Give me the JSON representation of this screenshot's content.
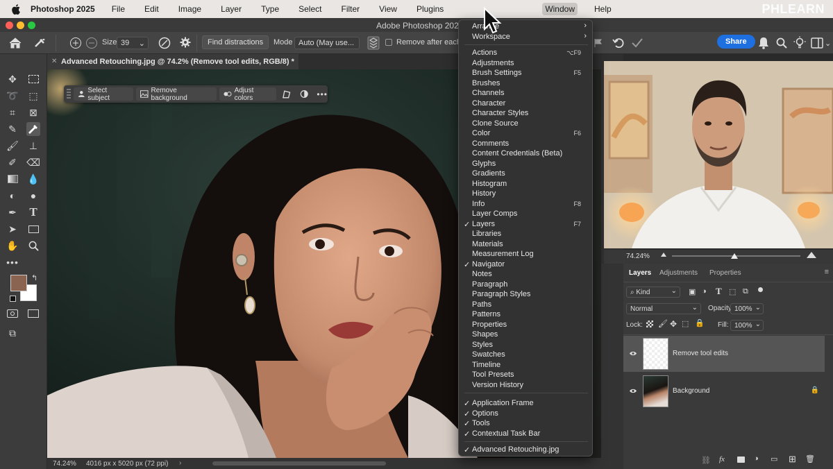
{
  "mac_menubar": {
    "app_name": "Photoshop 2025",
    "items": [
      "File",
      "Edit",
      "Image",
      "Layer",
      "Type",
      "Select",
      "Filter",
      "View",
      "Plugins",
      "Window",
      "Help"
    ],
    "active_item": "Window",
    "brand_watermark": "PHLEARN"
  },
  "window": {
    "title": "Adobe Photoshop 2025"
  },
  "options_bar": {
    "size_label": "Size",
    "size_value": "39",
    "find_distractions": "Find distractions",
    "mode_label": "Mode",
    "mode_value": "Auto (May use...",
    "remove_after_each": "Remove after each",
    "share": "Share"
  },
  "document": {
    "tab_title": "Advanced Retouching.jpg @ 74.2% (Remove tool edits, RGB/8) *",
    "zoom": "74.24%",
    "dimensions": "4016 px x 5020 px (72 ppi)"
  },
  "contextual_task_bar": {
    "select_subject": "Select subject",
    "remove_background": "Remove background",
    "adjust_colors": "Adjust colors"
  },
  "window_menu": {
    "top": [
      {
        "label": "Arrange",
        "submenu": true
      },
      {
        "label": "Workspace",
        "submenu": true
      }
    ],
    "panels": [
      {
        "label": "Actions",
        "shortcut": "⌥F9",
        "checked": false
      },
      {
        "label": "Adjustments",
        "shortcut": "",
        "checked": false
      },
      {
        "label": "Brush Settings",
        "shortcut": "F5",
        "checked": false
      },
      {
        "label": "Brushes",
        "shortcut": "",
        "checked": false
      },
      {
        "label": "Channels",
        "shortcut": "",
        "checked": false
      },
      {
        "label": "Character",
        "shortcut": "",
        "checked": false
      },
      {
        "label": "Character Styles",
        "shortcut": "",
        "checked": false
      },
      {
        "label": "Clone Source",
        "shortcut": "",
        "checked": false
      },
      {
        "label": "Color",
        "shortcut": "F6",
        "checked": false
      },
      {
        "label": "Comments",
        "shortcut": "",
        "checked": false
      },
      {
        "label": "Content Credentials (Beta)",
        "shortcut": "",
        "checked": false
      },
      {
        "label": "Glyphs",
        "shortcut": "",
        "checked": false
      },
      {
        "label": "Gradients",
        "shortcut": "",
        "checked": false
      },
      {
        "label": "Histogram",
        "shortcut": "",
        "checked": false
      },
      {
        "label": "History",
        "shortcut": "",
        "checked": false
      },
      {
        "label": "Info",
        "shortcut": "F8",
        "checked": false
      },
      {
        "label": "Layer Comps",
        "shortcut": "",
        "checked": false
      },
      {
        "label": "Layers",
        "shortcut": "F7",
        "checked": true
      },
      {
        "label": "Libraries",
        "shortcut": "",
        "checked": false
      },
      {
        "label": "Materials",
        "shortcut": "",
        "checked": false
      },
      {
        "label": "Measurement Log",
        "shortcut": "",
        "checked": false
      },
      {
        "label": "Navigator",
        "shortcut": "",
        "checked": true
      },
      {
        "label": "Notes",
        "shortcut": "",
        "checked": false
      },
      {
        "label": "Paragraph",
        "shortcut": "",
        "checked": false
      },
      {
        "label": "Paragraph Styles",
        "shortcut": "",
        "checked": false
      },
      {
        "label": "Paths",
        "shortcut": "",
        "checked": false
      },
      {
        "label": "Patterns",
        "shortcut": "",
        "checked": false
      },
      {
        "label": "Properties",
        "shortcut": "",
        "checked": false
      },
      {
        "label": "Shapes",
        "shortcut": "",
        "checked": false
      },
      {
        "label": "Styles",
        "shortcut": "",
        "checked": false
      },
      {
        "label": "Swatches",
        "shortcut": "",
        "checked": false
      },
      {
        "label": "Timeline",
        "shortcut": "",
        "checked": false
      },
      {
        "label": "Tool Presets",
        "shortcut": "",
        "checked": false
      },
      {
        "label": "Version History",
        "shortcut": "",
        "checked": false
      }
    ],
    "ui": [
      {
        "label": "Application Frame",
        "checked": true
      },
      {
        "label": "Options",
        "checked": true
      },
      {
        "label": "Tools",
        "checked": true
      },
      {
        "label": "Contextual Task Bar",
        "checked": true
      }
    ],
    "documents": [
      {
        "label": "Advanced Retouching.jpg",
        "checked": true
      }
    ]
  },
  "navigator": {
    "zoom": "74.24%"
  },
  "layers_panel": {
    "tabs": [
      "Layers",
      "Adjustments",
      "Properties"
    ],
    "active_tab": "Layers",
    "filter": "Kind",
    "blend_mode": "Normal",
    "opacity_label": "Opacity:",
    "opacity": "100%",
    "lock_label": "Lock:",
    "fill_label": "Fill:",
    "fill": "100%",
    "layers": [
      {
        "name": "Remove tool edits",
        "selected": true,
        "locked": false
      },
      {
        "name": "Background",
        "selected": false,
        "locked": true
      }
    ]
  },
  "colors": {
    "foreground": "#8a6450",
    "background": "#ffffff",
    "accent": "#1e6fe0"
  }
}
